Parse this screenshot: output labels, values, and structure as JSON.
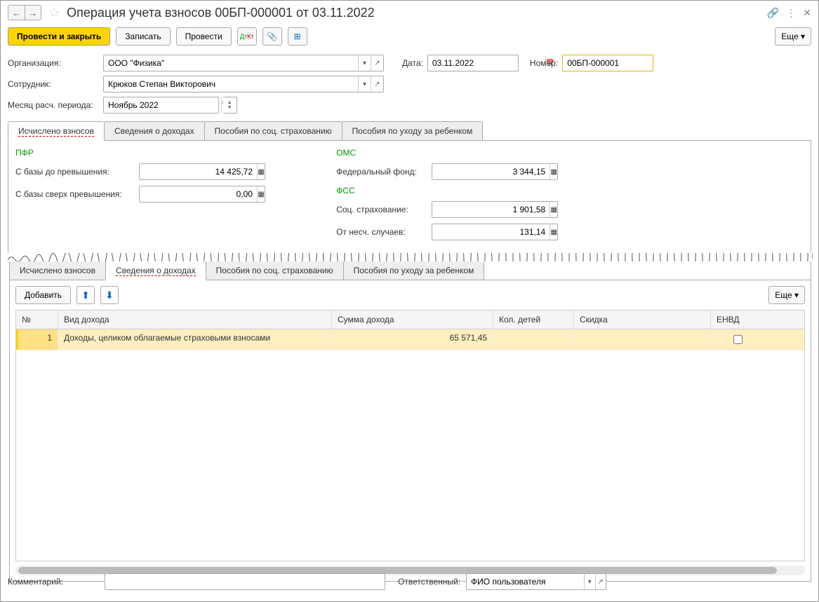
{
  "title": "Операция учета взносов 00БП-000001 от 03.11.2022",
  "toolbar": {
    "post_close": "Провести и закрыть",
    "save": "Записать",
    "post": "Провести",
    "more": "Еще"
  },
  "form": {
    "org_label": "Организация:",
    "org_value": "ООО \"Физика\"",
    "date_label": "Дата:",
    "date_value": "03.11.2022",
    "number_label": "Номер:",
    "number_value": "00БП-000001",
    "employee_label": "Сотрудник:",
    "employee_value": "Крюков Степан Викторович",
    "period_label": "Месяц расч. периода:",
    "period_value": "Ноябрь 2022"
  },
  "tabs": {
    "t1": "Исчислено взносов",
    "t2": "Сведения о доходах",
    "t3": "Пособия по соц. страхованию",
    "t4": "Пособия по уходу за ребенком"
  },
  "pfr": {
    "title": "ПФР",
    "base_below_label": "С базы до превышения:",
    "base_below_value": "14 425,72",
    "base_above_label": "С базы сверх превышения:",
    "base_above_value": "0,00"
  },
  "oms": {
    "title": "ОМС",
    "fed_label": "Федеральный фонд:",
    "fed_value": "3 344,15"
  },
  "fss": {
    "title": "ФСС",
    "soc_label": "Соц. страхование:",
    "soc_value": "1 901,58",
    "acc_label": "От несч. случаев:",
    "acc_value": "131,14"
  },
  "table": {
    "add": "Добавить",
    "more": "Еще",
    "headers": {
      "n": "№",
      "type": "Вид дохода",
      "sum": "Сумма дохода",
      "kids": "Кол. детей",
      "disc": "Скидка",
      "envd": "ЕНВД"
    },
    "rows": [
      {
        "n": "1",
        "type": "Доходы, целиком облагаемые страховыми взносами",
        "sum": "65 571,45",
        "kids": "",
        "disc": "",
        "envd": false
      }
    ]
  },
  "bottom": {
    "comment_label": "Комментарий:",
    "resp_label": "Ответственный:",
    "resp_value": "ФИО пользователя"
  }
}
